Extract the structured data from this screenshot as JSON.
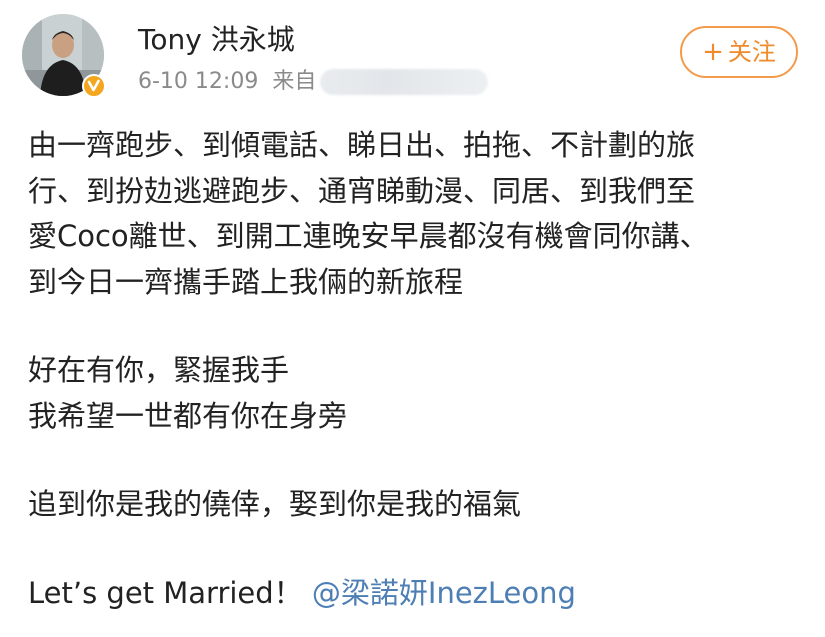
{
  "post": {
    "author": {
      "name": "Tony 洪永城",
      "avatar_icon": "user-avatar-photo",
      "verified_icon": "verified-v-icon",
      "verified_color": "#f4a71e"
    },
    "meta": {
      "time": "6-10 12:09",
      "source_label": "来自"
    },
    "follow_button": {
      "plus": "+",
      "label": "关注",
      "color": "#f08a2b"
    },
    "body": {
      "paragraph1": [
        "由一齊跑步、到傾電話、睇日出、拍拖、不計劃的旅",
        "行、到扮攰逃避跑步、通宵睇動漫、同居、到我們至",
        "愛Coco離世、到開工連晚安早晨都沒有機會同你講、",
        "到今日一齊攜手踏上我倆的新旅程"
      ],
      "paragraph2": [
        "好在有你，緊握我手",
        "我希望一世都有你在身旁"
      ],
      "paragraph3": [
        "追到你是我的僥倖，娶到你是我的福氣"
      ],
      "closing_text": "Let’s get Married！",
      "mention": "@梁諾妍InezLeong",
      "mention_color": "#4d7fb5"
    }
  }
}
